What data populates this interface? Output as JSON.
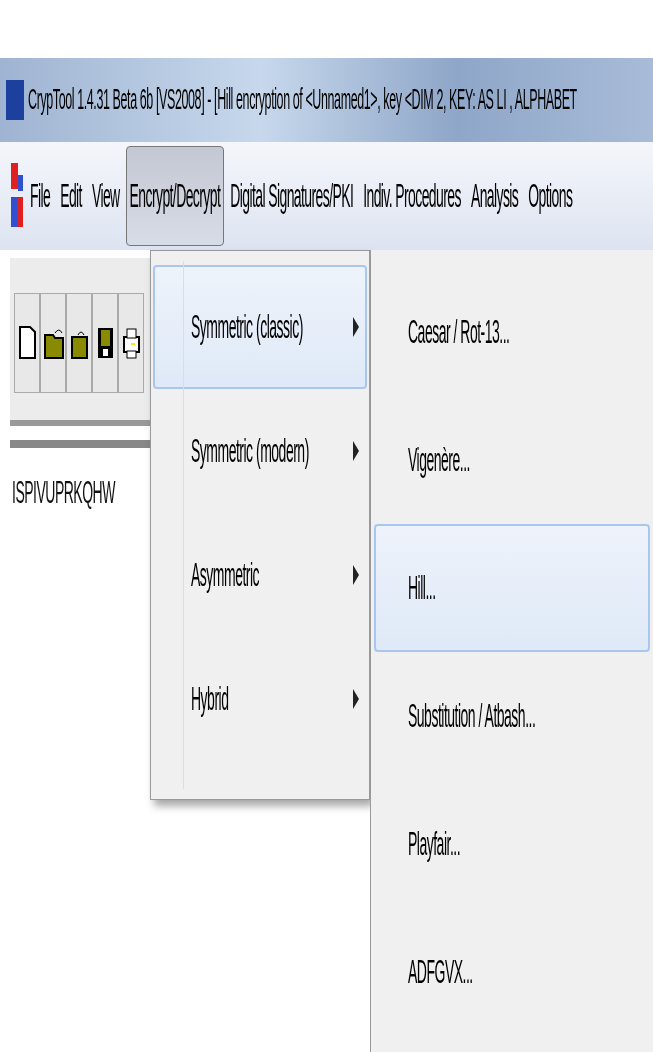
{
  "window": {
    "title": "CrypTool 1.4.31 Beta 6b [VS2008] - [Hill encryption of <Unnamed1>, key <DIM 2, KEY: AS LI , ALPHABET"
  },
  "menu_bar": [
    {
      "label": "File",
      "selected": false
    },
    {
      "label": "Edit",
      "selected": false
    },
    {
      "label": "View",
      "selected": false
    },
    {
      "label": "Encrypt/Decrypt",
      "selected": true
    },
    {
      "label": "Digital Signatures/PKI",
      "selected": false
    },
    {
      "label": "Indiv. Procedures",
      "selected": false
    },
    {
      "label": "Analysis",
      "selected": false
    },
    {
      "label": "Options",
      "selected": false
    }
  ],
  "toolbar": [
    {
      "kind": "new"
    },
    {
      "kind": "open"
    },
    {
      "kind": "close"
    },
    {
      "kind": "save"
    },
    {
      "kind": "print"
    }
  ],
  "document": {
    "text": "ISPIVUPRKQHW"
  },
  "menu": [
    {
      "label": "Symmetric (classic)",
      "selected": true
    },
    {
      "label": "Symmetric (modern)",
      "selected": false
    },
    {
      "label": "Asymmetric",
      "selected": false
    },
    {
      "label": "Hybrid",
      "selected": false
    }
  ],
  "submenu": [
    {
      "label": "Caesar / Rot-13...",
      "selected": false
    },
    {
      "label": "Vigenère...",
      "selected": false
    },
    {
      "label": "Hill...",
      "selected": true
    },
    {
      "label": "Substitution / Atbash...",
      "selected": false
    },
    {
      "label": "Playfair...",
      "selected": false
    },
    {
      "label": "ADFGVX...",
      "selected": false
    }
  ]
}
